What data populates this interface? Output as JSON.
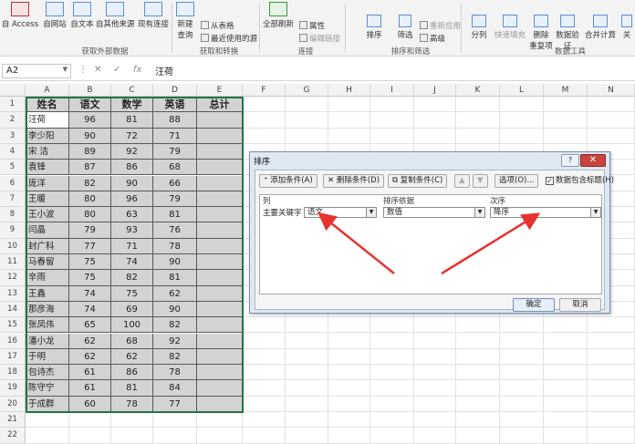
{
  "ribbon": {
    "get_external_group": "获取外部数据",
    "transform_group": "获取和转换",
    "connections_group": "连接",
    "sort_filter_group": "排序和筛选",
    "data_tools_group": "数据工具",
    "btn_access": "自 Access",
    "btn_web": "自网站",
    "btn_text": "自文本",
    "btn_other": "自其他来源",
    "btn_existing": "现有连接",
    "btn_newquery": "新建\n查询",
    "btn_fromtable": "从表格",
    "btn_recent": "最近使用的源",
    "btn_refresh": "全部刷新",
    "btn_properties": "属性",
    "btn_editlinks": "编辑链接",
    "btn_sort": "排序",
    "btn_filter": "筛选",
    "btn_reapply": "重新应用",
    "btn_advanced": "高级",
    "btn_split": "分列",
    "btn_flashfill": "快速填充",
    "btn_removedup": "删除\n重复项",
    "btn_validation": "数据验\n证",
    "btn_consolidate": "合并计算",
    "btn_relations": "关"
  },
  "formula_bar": {
    "name_box": "A2",
    "content": "汪荷"
  },
  "columns": [
    "A",
    "B",
    "C",
    "D",
    "E",
    "F",
    "G",
    "H",
    "I",
    "J",
    "K",
    "L",
    "M",
    "N"
  ],
  "headers": [
    "姓名",
    "语文",
    "数学",
    "英语",
    "总计"
  ],
  "rows": [
    [
      "汪荷",
      "96",
      "81",
      "88"
    ],
    [
      "李少阳",
      "90",
      "72",
      "71"
    ],
    [
      "宋  洁",
      "89",
      "92",
      "79"
    ],
    [
      "袁锋",
      "87",
      "86",
      "68"
    ],
    [
      "庞洋",
      "82",
      "90",
      "66"
    ],
    [
      "王暖",
      "80",
      "96",
      "79"
    ],
    [
      "王小波",
      "80",
      "63",
      "81"
    ],
    [
      "闫晶",
      "79",
      "93",
      "76"
    ],
    [
      "封广科",
      "77",
      "71",
      "78"
    ],
    [
      "马春留",
      "75",
      "74",
      "90"
    ],
    [
      "辛雨",
      "75",
      "82",
      "81"
    ],
    [
      "王鑫",
      "74",
      "75",
      "62"
    ],
    [
      "那彦海",
      "74",
      "69",
      "90"
    ],
    [
      "张凤伟",
      "65",
      "100",
      "82"
    ],
    [
      "潘小龙",
      "62",
      "68",
      "92"
    ],
    [
      "于明",
      "62",
      "62",
      "82"
    ],
    [
      "包诗杰",
      "61",
      "86",
      "78"
    ],
    [
      "陈守宁",
      "61",
      "81",
      "84"
    ],
    [
      "于成群",
      "60",
      "78",
      "77"
    ]
  ],
  "row_numbers": [
    "1",
    "2",
    "3",
    "4",
    "5",
    "6",
    "7",
    "8",
    "9",
    "10",
    "11",
    "12",
    "13",
    "14",
    "15",
    "16",
    "17",
    "18",
    "19",
    "20",
    "21",
    "22"
  ],
  "dialog": {
    "title": "排序",
    "help": "?",
    "close": "✕",
    "add_level": "添加条件(A)",
    "delete_level": "删除条件(D)",
    "copy_level": "复制条件(C)",
    "up": "▲",
    "down": "▼",
    "options": "选项(O)...",
    "has_headers": "数据包含标题(H)",
    "col_header": "列",
    "sort_on_header": "排序依据",
    "order_header": "次序",
    "key_label": "主要关键字",
    "key_value": "语文",
    "sort_on_value": "数值",
    "order_value": "降序",
    "ok": "确定",
    "cancel": "取消"
  },
  "colors": {
    "selection_fill": "#d3d3d3",
    "selection_border": "#217346",
    "arrow": "#e8322e"
  }
}
